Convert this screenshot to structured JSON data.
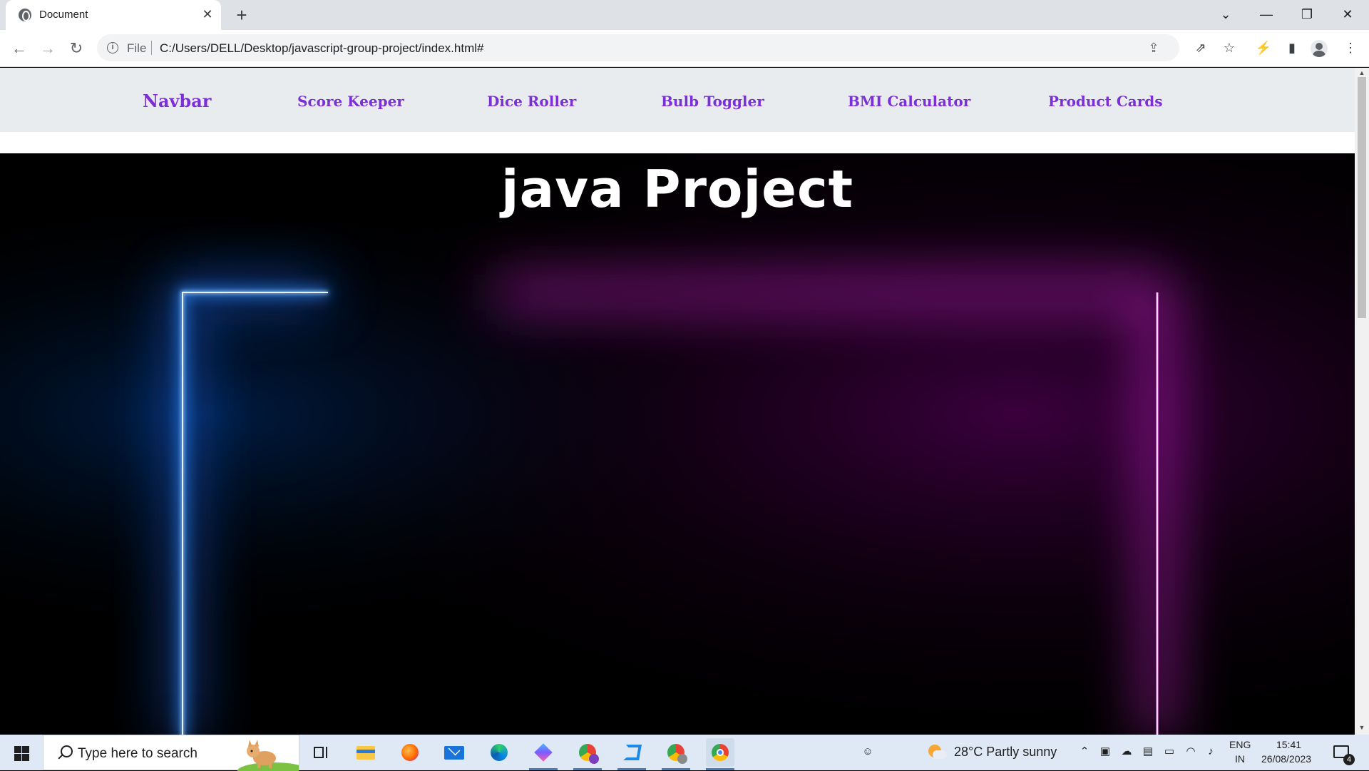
{
  "browser": {
    "tab_title": "Document",
    "tab_close": "✕",
    "new_tab": "+",
    "window_controls": {
      "tab_search": "⌄",
      "minimize": "—",
      "restore": "❐",
      "close": "✕"
    },
    "address": {
      "scheme_label": "File",
      "url": "C:/Users/DELL/Desktop/javascript-group-project/index.html#"
    },
    "nav_glyphs": {
      "back": "←",
      "forward": "→",
      "reload": "↻"
    },
    "icons": [
      "info-icon",
      "share-icon",
      "bookmark-star-icon",
      "extensions-icon",
      "side-panel-icon",
      "profile-icon",
      "menu-icon"
    ]
  },
  "page": {
    "navbar": {
      "brand": "Navbar",
      "links": [
        "Score Keeper",
        "Dice Roller",
        "Bulb Toggler",
        "BMI Calculator",
        "Product Cards"
      ]
    },
    "hero": {
      "title": "java Project",
      "colors": {
        "left_glow": "#2f8cff",
        "right_glow": "#ff2cff",
        "background": "#000000"
      }
    }
  },
  "taskbar": {
    "search_placeholder": "Type here to search",
    "apps": [
      "task-view",
      "file-explorer",
      "firefox",
      "mail",
      "edge",
      "app-blue-diamond",
      "chrome-profile-p",
      "vscode",
      "chrome-profile-p2",
      "chrome"
    ],
    "weather": "28°C  Partly sunny",
    "language_line1": "ENG",
    "language_line2": "IN",
    "time": "15:41",
    "date": "26/08/2023",
    "notifications_count": "4"
  }
}
